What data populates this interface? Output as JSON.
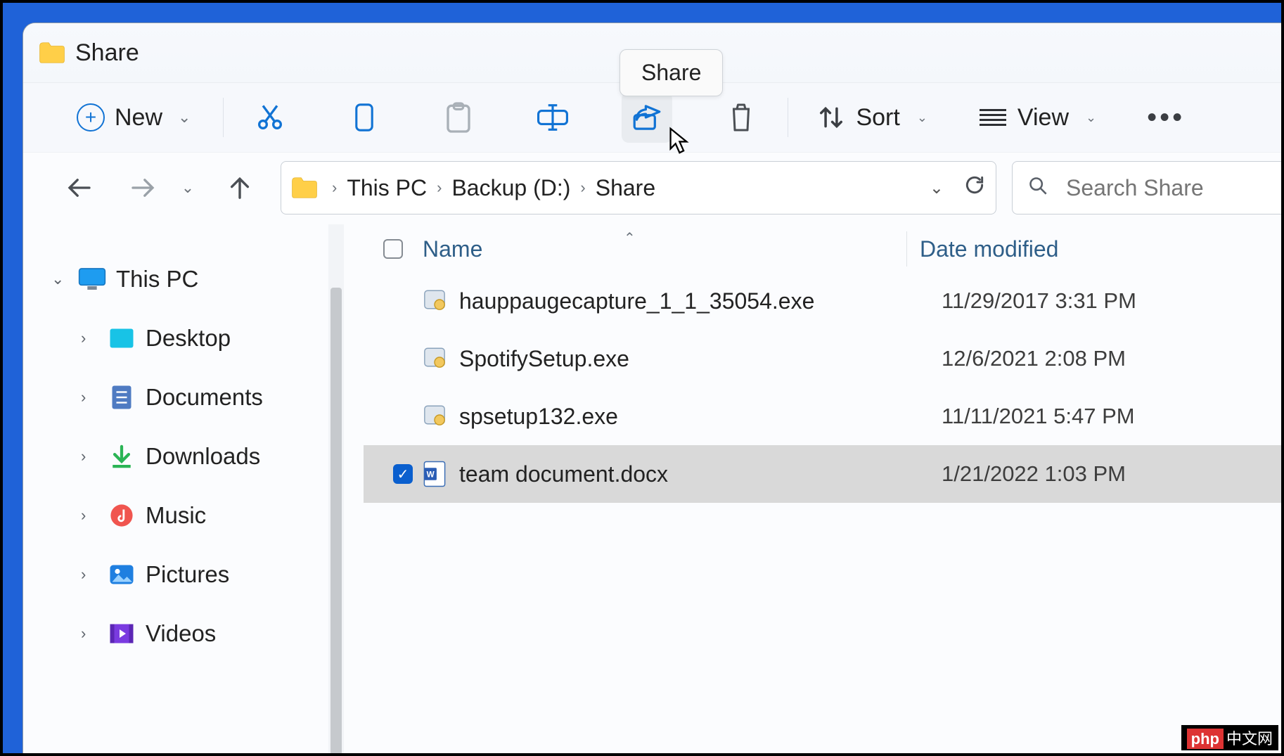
{
  "window": {
    "title": "Share"
  },
  "toolbar": {
    "new_label": "New",
    "sort_label": "Sort",
    "view_label": "View",
    "share_tooltip": "Share"
  },
  "breadcrumb": {
    "items": [
      "This PC",
      "Backup (D:)",
      "Share"
    ]
  },
  "search": {
    "placeholder": "Search Share"
  },
  "sidebar": {
    "root": "This PC",
    "items": [
      {
        "label": "Desktop"
      },
      {
        "label": "Documents"
      },
      {
        "label": "Downloads"
      },
      {
        "label": "Music"
      },
      {
        "label": "Pictures"
      },
      {
        "label": "Videos"
      }
    ]
  },
  "columns": {
    "name": "Name",
    "date": "Date modified"
  },
  "files": [
    {
      "name": "hauppaugecapture_1_1_35054.exe",
      "date": "11/29/2017 3:31 PM",
      "selected": false,
      "type": "exe"
    },
    {
      "name": "SpotifySetup.exe",
      "date": "12/6/2021 2:08 PM",
      "selected": false,
      "type": "exe"
    },
    {
      "name": "spsetup132.exe",
      "date": "11/11/2021 5:47 PM",
      "selected": false,
      "type": "exe"
    },
    {
      "name": "team document.docx",
      "date": "1/21/2022 1:03 PM",
      "selected": true,
      "type": "docx"
    }
  ],
  "watermark": {
    "a": "php",
    "b": "中文网"
  }
}
